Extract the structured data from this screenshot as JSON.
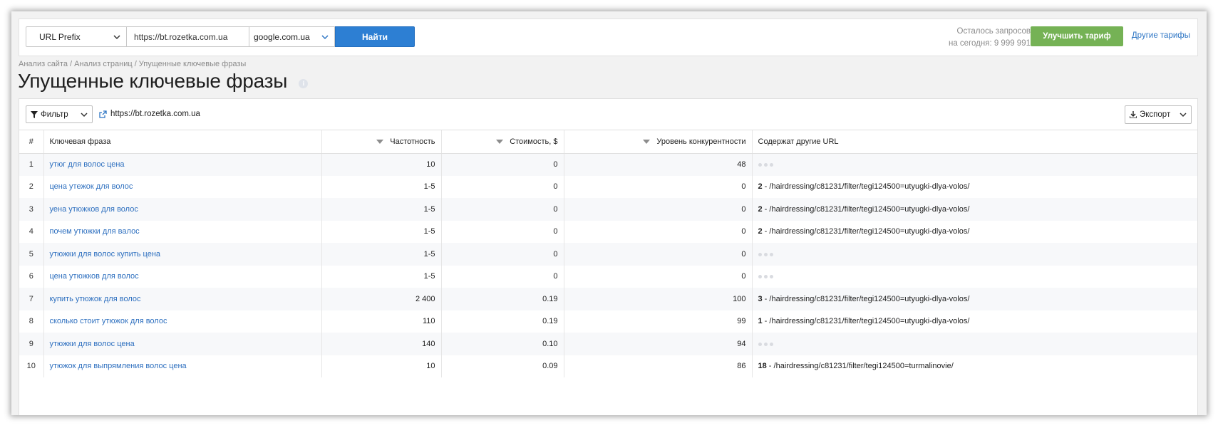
{
  "topbar": {
    "search_type": "URL Prefix",
    "url_value": "https://bt.rozetka.com.ua",
    "engine": "google.com.ua",
    "find_label": "Найти",
    "quota_line1": "Осталось запросов",
    "quota_line2": "на сегодня: 9 999 991",
    "upgrade_label": "Улучшить тариф",
    "other_tariffs_label": "Другие тарифы"
  },
  "breadcrumb": "Анализ сайта / Анализ страниц / Упущенные ключевые фразы",
  "page_title": "Упущенные ключевые фразы",
  "toolbar": {
    "filter_label": "Фильтр",
    "site_url": "https://bt.rozetka.com.ua",
    "export_label": "Экспорт"
  },
  "table": {
    "headers": {
      "index": "#",
      "keyword": "Ключевая фраза",
      "frequency": "Частотность",
      "cost": "Стоимость, $",
      "competition": "Уровень конкурентности",
      "other_urls": "Содержат другие URL"
    },
    "rows": [
      {
        "index": "1",
        "keyword": "утюг для волос цена",
        "frequency": "10",
        "cost": "0",
        "competition": "48",
        "url_count": "",
        "url": ""
      },
      {
        "index": "2",
        "keyword": "цена утежок для волос",
        "frequency": "1-5",
        "cost": "0",
        "competition": "0",
        "url_count": "2",
        "url": "/hairdressing/c81231/filter/tegi124500=utyugki-dlya-volos/"
      },
      {
        "index": "3",
        "keyword": "уена утюжков для волос",
        "frequency": "1-5",
        "cost": "0",
        "competition": "0",
        "url_count": "2",
        "url": "/hairdressing/c81231/filter/tegi124500=utyugki-dlya-volos/"
      },
      {
        "index": "4",
        "keyword": "почем утюжки для валос",
        "frequency": "1-5",
        "cost": "0",
        "competition": "0",
        "url_count": "2",
        "url": "/hairdressing/c81231/filter/tegi124500=utyugki-dlya-volos/"
      },
      {
        "index": "5",
        "keyword": "утюжки для волос купить цена",
        "frequency": "1-5",
        "cost": "0",
        "competition": "0",
        "url_count": "",
        "url": ""
      },
      {
        "index": "6",
        "keyword": "цена утюжков для волос",
        "frequency": "1-5",
        "cost": "0",
        "competition": "0",
        "url_count": "",
        "url": ""
      },
      {
        "index": "7",
        "keyword": "купить утюжок для волос",
        "frequency": "2 400",
        "cost": "0.19",
        "competition": "100",
        "url_count": "3",
        "url": "/hairdressing/c81231/filter/tegi124500=utyugki-dlya-volos/"
      },
      {
        "index": "8",
        "keyword": "сколько стоит утюжок для волос",
        "frequency": "110",
        "cost": "0.19",
        "competition": "99",
        "url_count": "1",
        "url": "/hairdressing/c81231/filter/tegi124500=utyugki-dlya-volos/"
      },
      {
        "index": "9",
        "keyword": "утюжки для волос цена",
        "frequency": "140",
        "cost": "0.10",
        "competition": "94",
        "url_count": "",
        "url": ""
      },
      {
        "index": "10",
        "keyword": "утюжок для выпрямления волос цена",
        "frequency": "10",
        "cost": "0.09",
        "competition": "86",
        "url_count": "18",
        "url": "/hairdressing/c81231/filter/tegi124500=turmalinovie/"
      }
    ]
  },
  "colors": {
    "primary_button": "#2d7fd3",
    "upgrade_button": "#75b255",
    "link": "#2d6fbf"
  }
}
